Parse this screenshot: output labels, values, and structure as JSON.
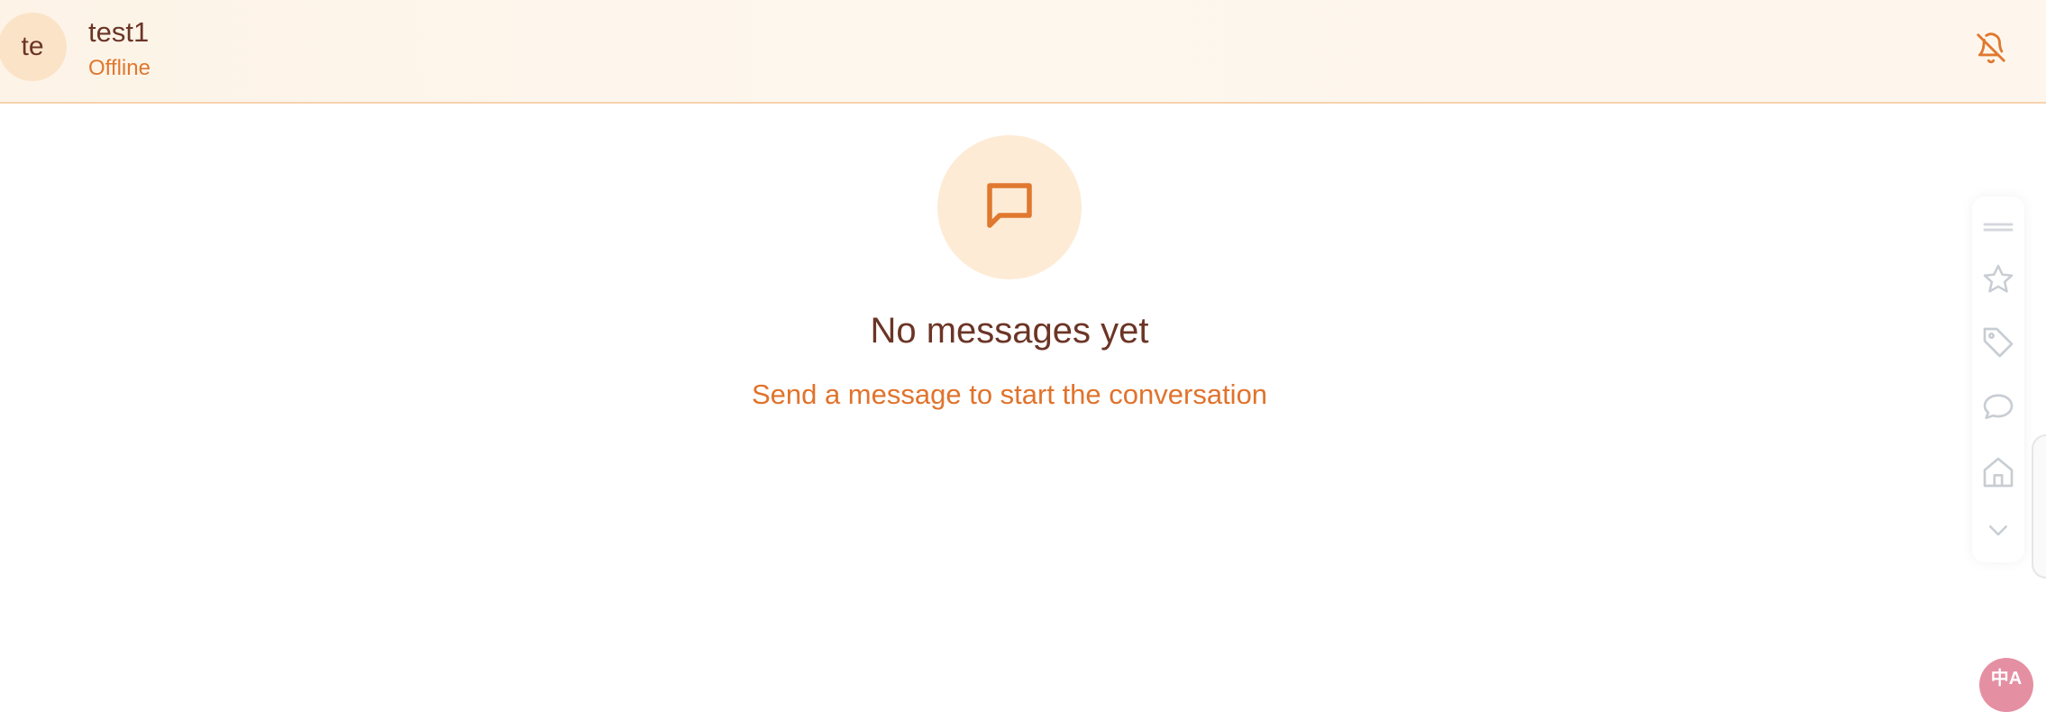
{
  "header": {
    "avatar_initials": "te",
    "contact_name": "test1",
    "status": "Offline",
    "mute_icon": "bell-off-icon"
  },
  "empty_state": {
    "icon": "message-square-icon",
    "title": "No messages yet",
    "subtitle": "Send a message to start the conversation"
  },
  "toolbar": {
    "items": [
      {
        "icon": "drag-handle-icon"
      },
      {
        "icon": "star-icon"
      },
      {
        "icon": "tag-icon"
      },
      {
        "icon": "chat-bubble-icon"
      },
      {
        "icon": "home-icon"
      },
      {
        "icon": "chevron-down-icon"
      }
    ]
  },
  "translate_badge": {
    "label": "中A"
  },
  "colors": {
    "accent": "#e0782f",
    "dark_text": "#6b3526",
    "header_bg": "#fdf3e7",
    "icon_circle_bg": "#fdebd6",
    "toolbar_icon": "#c8cdd3",
    "badge_pink": "#e58fa3"
  }
}
